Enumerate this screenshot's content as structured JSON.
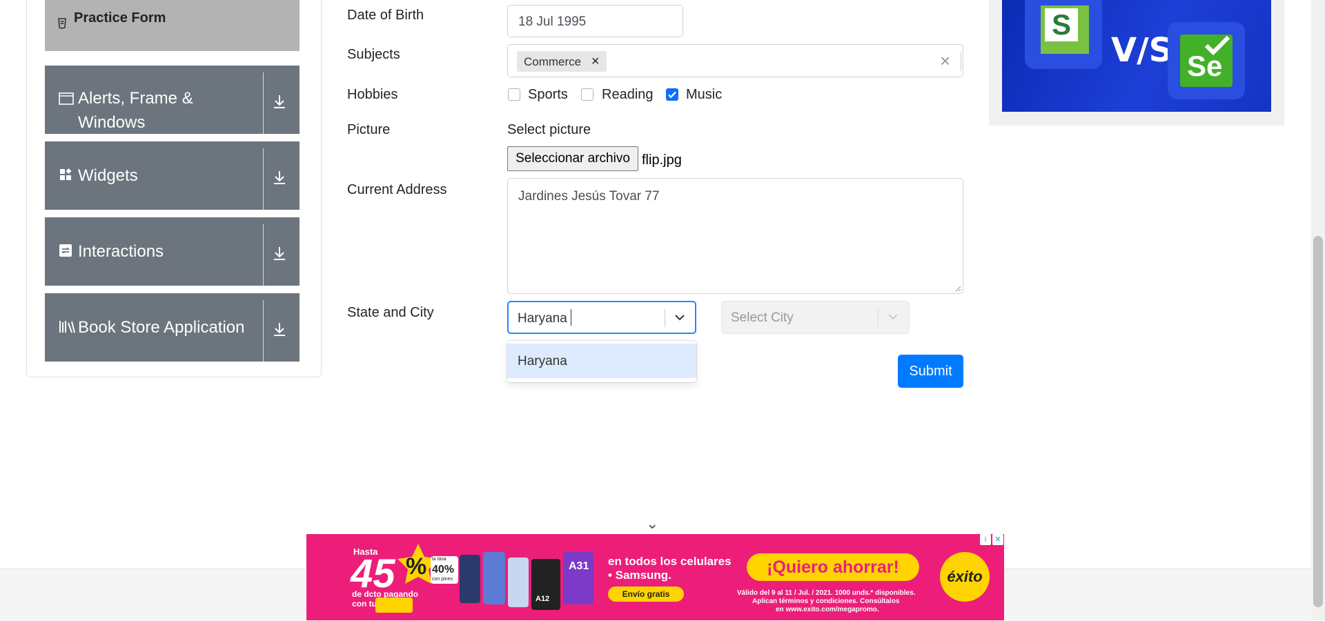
{
  "sidebar": {
    "active_item": {
      "label": "Practice Form",
      "icon": "form-icon"
    },
    "groups": [
      {
        "label_line1": "Alerts, Frame &",
        "label_line2": "Windows",
        "icon": "window-icon"
      },
      {
        "label": "Widgets",
        "icon": "widgets-icon"
      },
      {
        "label": "Interactions",
        "icon": "interactions-icon"
      },
      {
        "label": "Book Store Application",
        "icon": "books-icon"
      }
    ]
  },
  "form": {
    "dob": {
      "label": "Date of Birth",
      "value": "18 Jul 1995"
    },
    "subjects": {
      "label": "Subjects",
      "tags": [
        "Commerce"
      ],
      "remove_glyph": "×",
      "clear_glyph": "×"
    },
    "hobbies": {
      "label": "Hobbies",
      "options": [
        {
          "label": "Sports",
          "checked": false
        },
        {
          "label": "Reading",
          "checked": false
        },
        {
          "label": "Music",
          "checked": true
        }
      ]
    },
    "picture": {
      "label": "Picture",
      "caption": "Select picture",
      "button_label": "Seleccionar archivo",
      "file_name": "flip.jpg"
    },
    "address": {
      "label": "Current Address",
      "value": "Jardines Jesús Tovar 77"
    },
    "state_city": {
      "label": "State and City",
      "state_value": "Haryana",
      "state_options": [
        "Haryana"
      ],
      "city_placeholder": "Select City"
    },
    "submit_label": "Submit"
  },
  "ads": {
    "right_banner": {
      "left_logo": "S",
      "middle": "V/S",
      "right_logo": "Se"
    },
    "bottom_banner": {
      "hasta": "Hasta",
      "big_percent": "45",
      "percent_sign": "%",
      "small_badge_top": "la tasa",
      "small_badge_pct": "40%",
      "small_badge_bottom": "con pines",
      "sub1": "de dcto pagando",
      "sub2": "con tu",
      "headline1": "en todos los celulares",
      "headline2": "• Samsung.",
      "shipping": "Envío gratis",
      "cta": "¡Quiero ahorrar!",
      "legal1": "Válido del 9 al 11 / Jul. / 2021. 1000 unds.* disponibles.",
      "legal2": "Aplican términos y condiciones. Consúltalos",
      "legal3": "en www.exito.com/megapromo.",
      "brand": "éxito",
      "phone_labels": [
        "A12",
        "A31"
      ],
      "close_glyph": "✕",
      "info_glyph": "i"
    },
    "collapse_glyph": "⌄"
  },
  "colors": {
    "accent": "#007bff",
    "sidebar_group": "#6c757d",
    "sidebar_active": "#b3b3b3",
    "ad_pink": "#ec1e79"
  }
}
